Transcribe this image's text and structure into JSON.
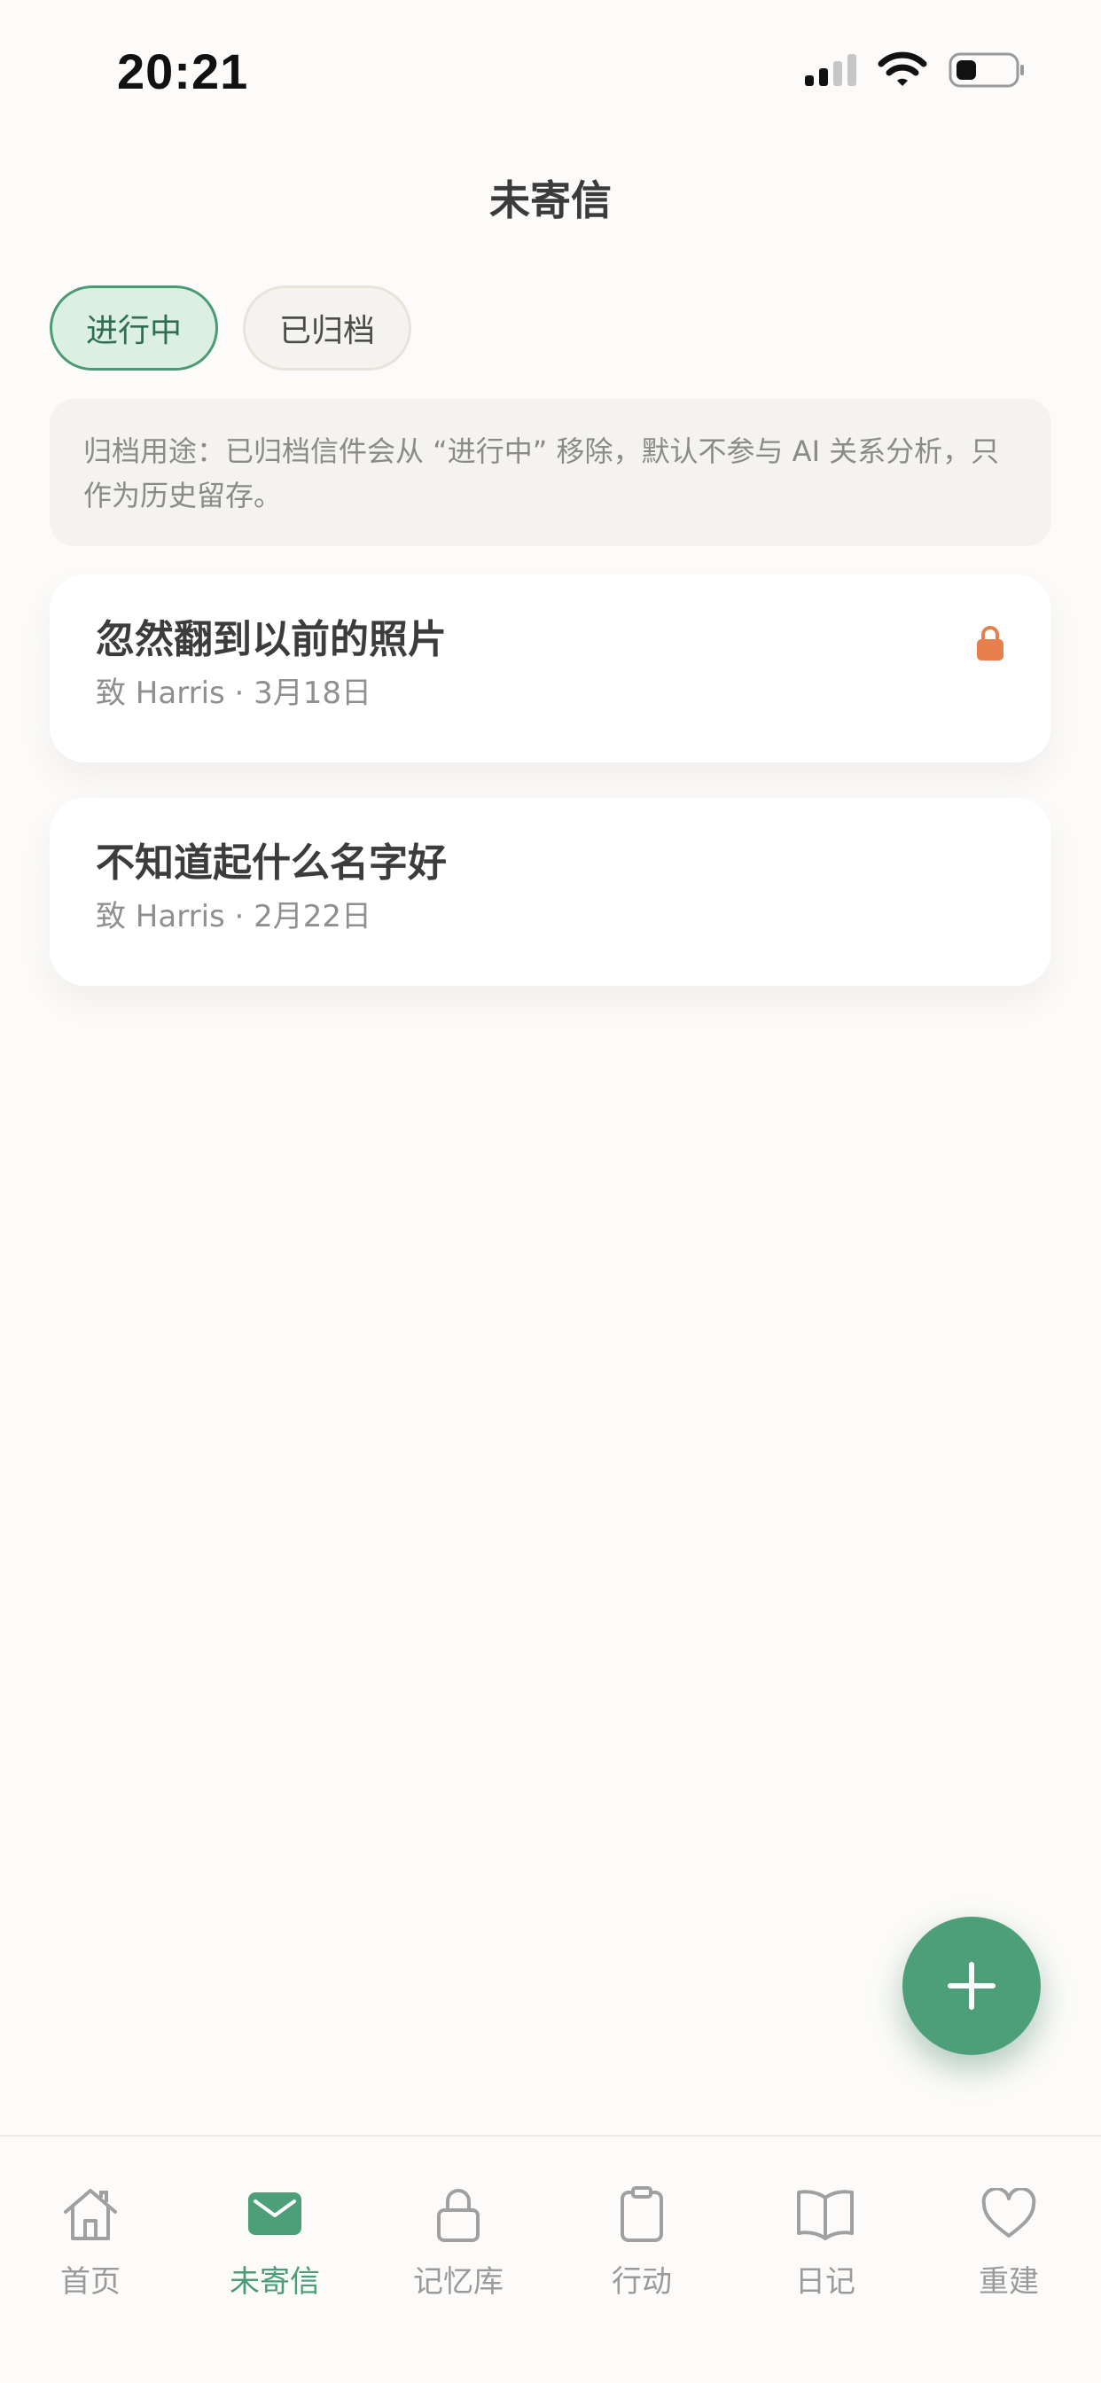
{
  "status_bar": {
    "time": "20:21"
  },
  "header": {
    "title": "未寄信"
  },
  "tabs": [
    {
      "label": "进行中",
      "active": true
    },
    {
      "label": "已归档",
      "active": false
    }
  ],
  "notice": {
    "text": "归档用途：已归档信件会从 “进行中” 移除，默认不参与 AI 关系分析，只作为历史留存。"
  },
  "letters": [
    {
      "title": "忽然翻到以前的照片",
      "meta": "致 Harris · 3月18日",
      "locked": true
    },
    {
      "title": "不知道起什么名字好",
      "meta": "致 Harris · 2月22日",
      "locked": false
    }
  ],
  "fab": {
    "icon": "plus-icon"
  },
  "tab_bar": {
    "items": [
      {
        "label": "首页",
        "icon": "home-icon",
        "active": false
      },
      {
        "label": "未寄信",
        "icon": "mail-icon",
        "active": true
      },
      {
        "label": "记忆库",
        "icon": "lock-icon",
        "active": false
      },
      {
        "label": "行动",
        "icon": "clipboard-icon",
        "active": false
      },
      {
        "label": "日记",
        "icon": "book-icon",
        "active": false
      },
      {
        "label": "重建",
        "icon": "heart-icon",
        "active": false
      }
    ]
  },
  "colors": {
    "accent": "#4d9f7a",
    "lock": "#e8804e",
    "background": "#fcfbf9"
  }
}
